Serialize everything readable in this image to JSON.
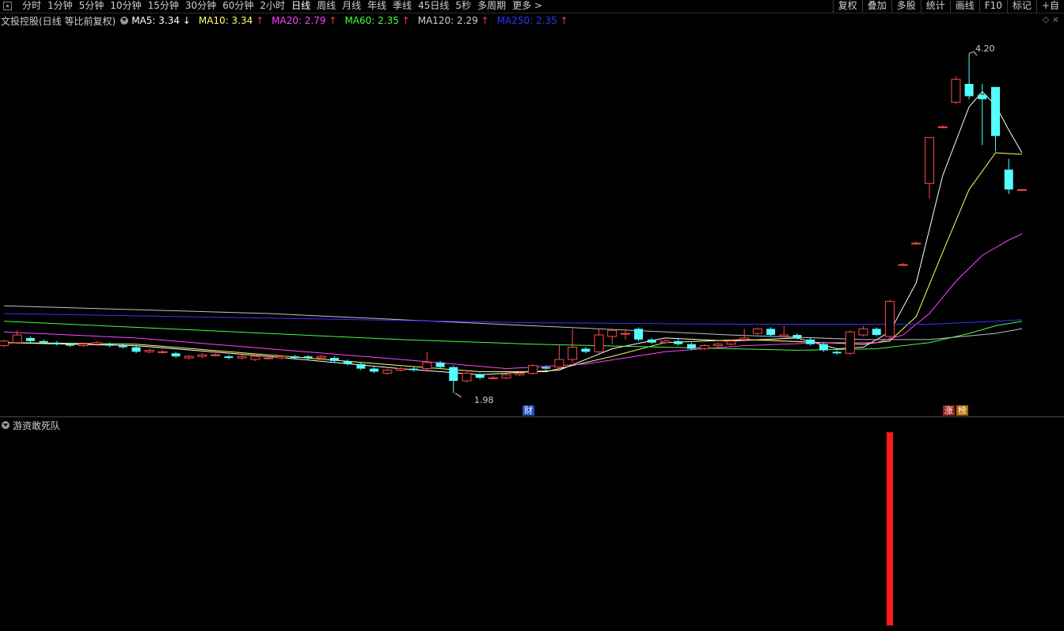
{
  "toolbar": {
    "periods": [
      "分时",
      "1分钟",
      "5分钟",
      "10分钟",
      "15分钟",
      "30分钟",
      "60分钟",
      "2小时",
      "日线",
      "周线",
      "月线",
      "年线",
      "季线",
      "45日线",
      "5秒",
      "多周期",
      "更多 >"
    ],
    "active_period": "日线",
    "right_tools": [
      "复权",
      "叠加",
      "多股",
      "统计",
      "画线",
      "F10",
      "标记",
      "+自"
    ]
  },
  "info": {
    "title": "文投控股(日线 等比前复权)",
    "ma": [
      {
        "label": "MA5: 3.34",
        "arrow": "↓",
        "color": "#ffffff"
      },
      {
        "label": "MA10: 3.34",
        "arrow": "↑",
        "color": "#ffff66"
      },
      {
        "label": "MA20: 2.79",
        "arrow": "↑",
        "color": "#ff44ff"
      },
      {
        "label": "MA60: 2.35",
        "arrow": "↑",
        "color": "#44ff44"
      },
      {
        "label": "MA120: 2.29",
        "arrow": "↑",
        "color": "#d0d0d0"
      },
      {
        "label": "MA250: 2.35",
        "arrow": "↑",
        "color": "#3333ff"
      }
    ],
    "right_icons": "◇ ×"
  },
  "annotations": {
    "high": "4.20",
    "low": "1.98",
    "event_finance": "财",
    "event_limit": "涨",
    "event_list": "榜"
  },
  "indicator": {
    "name": "游资敢死队"
  },
  "colors": {
    "up": "#ff4a4a",
    "down": "#54ffff",
    "background": "#000000"
  },
  "chart_data": {
    "type": "candlestick",
    "price_range": [
      1.9,
      4.3
    ],
    "candles": [
      [
        2.29,
        2.32,
        2.28,
        2.33
      ],
      [
        2.31,
        2.36,
        2.3,
        2.39
      ],
      [
        2.34,
        2.32,
        2.31,
        2.35
      ],
      [
        2.32,
        2.31,
        2.3,
        2.33
      ],
      [
        2.31,
        2.3,
        2.29,
        2.32
      ],
      [
        2.3,
        2.29,
        2.28,
        2.31
      ],
      [
        2.29,
        2.3,
        2.28,
        2.31
      ],
      [
        2.3,
        2.31,
        2.29,
        2.32
      ],
      [
        2.3,
        2.29,
        2.28,
        2.31
      ],
      [
        2.29,
        2.28,
        2.27,
        2.3
      ],
      [
        2.28,
        2.25,
        2.24,
        2.29
      ],
      [
        2.25,
        2.26,
        2.24,
        2.27
      ],
      [
        2.25,
        2.25,
        2.24,
        2.26
      ],
      [
        2.24,
        2.22,
        2.21,
        2.25
      ],
      [
        2.21,
        2.22,
        2.2,
        2.23
      ],
      [
        2.22,
        2.23,
        2.21,
        2.24
      ],
      [
        2.23,
        2.23,
        2.22,
        2.24
      ],
      [
        2.22,
        2.21,
        2.2,
        2.23
      ],
      [
        2.21,
        2.22,
        2.2,
        2.23
      ],
      [
        2.2,
        2.22,
        2.19,
        2.23
      ],
      [
        2.21,
        2.21,
        2.2,
        2.22
      ],
      [
        2.21,
        2.22,
        2.2,
        2.23
      ],
      [
        2.22,
        2.21,
        2.2,
        2.23
      ],
      [
        2.22,
        2.21,
        2.2,
        2.23
      ],
      [
        2.21,
        2.22,
        2.2,
        2.23
      ],
      [
        2.21,
        2.19,
        2.18,
        2.22
      ],
      [
        2.19,
        2.17,
        2.16,
        2.2
      ],
      [
        2.17,
        2.14,
        2.13,
        2.18
      ],
      [
        2.14,
        2.12,
        2.11,
        2.15
      ],
      [
        2.11,
        2.13,
        2.1,
        2.14
      ],
      [
        2.13,
        2.14,
        2.12,
        2.15
      ],
      [
        2.14,
        2.13,
        2.12,
        2.15
      ],
      [
        2.14,
        2.18,
        2.13,
        2.25
      ],
      [
        2.18,
        2.15,
        2.14,
        2.19
      ],
      [
        2.15,
        2.06,
        1.98,
        2.16
      ],
      [
        2.06,
        2.11,
        2.05,
        2.12
      ],
      [
        2.1,
        2.08,
        2.07,
        2.11
      ],
      [
        2.08,
        2.08,
        2.07,
        2.09
      ],
      [
        2.08,
        2.1,
        2.07,
        2.11
      ],
      [
        2.1,
        2.11,
        2.09,
        2.12
      ],
      [
        2.11,
        2.16,
        2.1,
        2.17
      ],
      [
        2.15,
        2.14,
        2.13,
        2.16
      ],
      [
        2.15,
        2.2,
        2.14,
        2.3
      ],
      [
        2.2,
        2.28,
        2.18,
        2.4
      ],
      [
        2.27,
        2.25,
        2.24,
        2.28
      ],
      [
        2.25,
        2.36,
        2.24,
        2.4
      ],
      [
        2.35,
        2.39,
        2.3,
        2.4
      ],
      [
        2.37,
        2.37,
        2.33,
        2.4
      ],
      [
        2.4,
        2.33,
        2.32,
        2.41
      ],
      [
        2.33,
        2.31,
        2.3,
        2.34
      ],
      [
        2.31,
        2.32,
        2.3,
        2.33
      ],
      [
        2.32,
        2.3,
        2.29,
        2.34
      ],
      [
        2.3,
        2.27,
        2.26,
        2.31
      ],
      [
        2.27,
        2.29,
        2.26,
        2.3
      ],
      [
        2.29,
        2.3,
        2.28,
        2.31
      ],
      [
        2.3,
        2.32,
        2.29,
        2.33
      ],
      [
        2.33,
        2.34,
        2.32,
        2.4
      ],
      [
        2.37,
        2.4,
        2.36,
        2.41
      ],
      [
        2.4,
        2.36,
        2.35,
        2.41
      ],
      [
        2.35,
        2.36,
        2.34,
        2.42
      ],
      [
        2.36,
        2.34,
        2.33,
        2.37
      ],
      [
        2.33,
        2.3,
        2.29,
        2.34
      ],
      [
        2.3,
        2.26,
        2.25,
        2.31
      ],
      [
        2.25,
        2.24,
        2.23,
        2.26
      ],
      [
        2.24,
        2.38,
        2.23,
        2.39
      ],
      [
        2.36,
        2.4,
        2.35,
        2.42
      ],
      [
        2.4,
        2.36,
        2.35,
        2.41
      ],
      [
        2.35,
        2.58,
        2.34,
        2.59
      ],
      [
        2.82,
        2.82,
        2.81,
        2.83
      ],
      [
        2.96,
        2.96,
        2.95,
        2.97
      ],
      [
        3.35,
        3.65,
        3.25,
        3.65
      ],
      [
        3.72,
        3.72,
        3.71,
        3.73
      ],
      [
        3.88,
        4.03,
        3.87,
        4.05
      ],
      [
        4.0,
        3.92,
        3.9,
        4.2
      ],
      [
        3.93,
        3.9,
        3.6,
        4.0
      ],
      [
        3.98,
        3.66,
        3.56,
        3.98
      ],
      [
        3.44,
        3.31,
        3.28,
        3.51
      ],
      [
        3.31,
        3.31,
        3.31,
        3.31
      ]
    ],
    "ma_series": [
      {
        "name": "MA5",
        "color": "#ffffff",
        "values": [
          [
            0,
            2.31
          ],
          [
            10,
            2.29
          ],
          [
            20,
            2.22
          ],
          [
            30,
            2.14
          ],
          [
            36,
            2.1
          ],
          [
            42,
            2.13
          ],
          [
            46,
            2.27
          ],
          [
            50,
            2.34
          ],
          [
            55,
            2.32
          ],
          [
            60,
            2.34
          ],
          [
            63,
            2.27
          ],
          [
            65,
            2.28
          ],
          [
            67,
            2.38
          ],
          [
            69,
            2.7
          ],
          [
            71,
            3.4
          ],
          [
            73,
            3.85
          ],
          [
            74,
            3.95
          ],
          [
            75,
            3.86
          ],
          [
            76,
            3.7
          ],
          [
            77,
            3.55
          ]
        ]
      },
      {
        "name": "MA10",
        "color": "#ffff66",
        "values": [
          [
            0,
            2.31
          ],
          [
            10,
            2.3
          ],
          [
            20,
            2.23
          ],
          [
            30,
            2.16
          ],
          [
            36,
            2.12
          ],
          [
            41,
            2.12
          ],
          [
            46,
            2.22
          ],
          [
            50,
            2.31
          ],
          [
            56,
            2.33
          ],
          [
            62,
            2.31
          ],
          [
            65,
            2.3
          ],
          [
            67,
            2.32
          ],
          [
            69,
            2.48
          ],
          [
            71,
            2.9
          ],
          [
            73,
            3.31
          ],
          [
            75,
            3.55
          ],
          [
            77,
            3.54
          ]
        ]
      },
      {
        "name": "MA20",
        "color": "#ff44ff",
        "values": [
          [
            0,
            2.38
          ],
          [
            10,
            2.34
          ],
          [
            20,
            2.27
          ],
          [
            30,
            2.2
          ],
          [
            38,
            2.14
          ],
          [
            44,
            2.17
          ],
          [
            50,
            2.25
          ],
          [
            56,
            2.29
          ],
          [
            62,
            2.31
          ],
          [
            66,
            2.31
          ],
          [
            68,
            2.36
          ],
          [
            70,
            2.5
          ],
          [
            72,
            2.71
          ],
          [
            74,
            2.88
          ],
          [
            76,
            2.98
          ],
          [
            77,
            3.02
          ]
        ]
      },
      {
        "name": "MA60",
        "color": "#44ff44",
        "values": [
          [
            0,
            2.45
          ],
          [
            15,
            2.39
          ],
          [
            30,
            2.33
          ],
          [
            40,
            2.3
          ],
          [
            50,
            2.28
          ],
          [
            60,
            2.26
          ],
          [
            66,
            2.27
          ],
          [
            70,
            2.31
          ],
          [
            73,
            2.37
          ],
          [
            75,
            2.42
          ],
          [
            77,
            2.45
          ]
        ]
      },
      {
        "name": "MA120",
        "color": "#c0c0c0",
        "values": [
          [
            0,
            2.55
          ],
          [
            20,
            2.5
          ],
          [
            40,
            2.42
          ],
          [
            55,
            2.36
          ],
          [
            65,
            2.33
          ],
          [
            70,
            2.33
          ],
          [
            75,
            2.37
          ],
          [
            77,
            2.4
          ]
        ]
      },
      {
        "name": "MA250",
        "color": "#3333ff",
        "values": [
          [
            0,
            2.5
          ],
          [
            20,
            2.47
          ],
          [
            40,
            2.44
          ],
          [
            55,
            2.43
          ],
          [
            65,
            2.43
          ],
          [
            70,
            2.43
          ],
          [
            75,
            2.45
          ],
          [
            77,
            2.46
          ]
        ]
      }
    ],
    "indicator_bars": [
      {
        "index": 67,
        "value": 1
      }
    ]
  }
}
